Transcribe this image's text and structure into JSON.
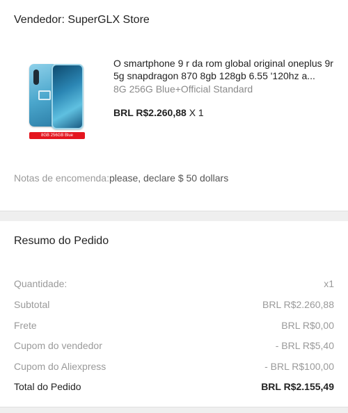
{
  "seller": {
    "label": "Vendedor: SuperGLX Store"
  },
  "product": {
    "title": "O smartphone 9 r da rom global original oneplus 9r 5g snapdragon 870 8gb 128gb 6.55 '120hz a...",
    "variant": "8G 256G Blue+Official Standard",
    "price": "BRL R$2.260,88",
    "quantity": "X 1",
    "image_badge": "8GB 256GB Blue"
  },
  "notes": {
    "label": "Notas de encomenda:",
    "value": "please, declare $ 50 dollars"
  },
  "summary": {
    "title": "Resumo do Pedido",
    "rows": [
      {
        "label": "Quantidade:",
        "value": "x1"
      },
      {
        "label": "Subtotal",
        "value": "BRL R$2.260,88"
      },
      {
        "label": "Frete",
        "value": "BRL R$0,00"
      },
      {
        "label": "Cupom do vendedor",
        "value": "- BRL R$5,40"
      },
      {
        "label": "Cupom do Aliexpress",
        "value": "- BRL R$100,00"
      },
      {
        "label": "Total do Pedido",
        "value": "BRL R$2.155,49"
      }
    ]
  }
}
